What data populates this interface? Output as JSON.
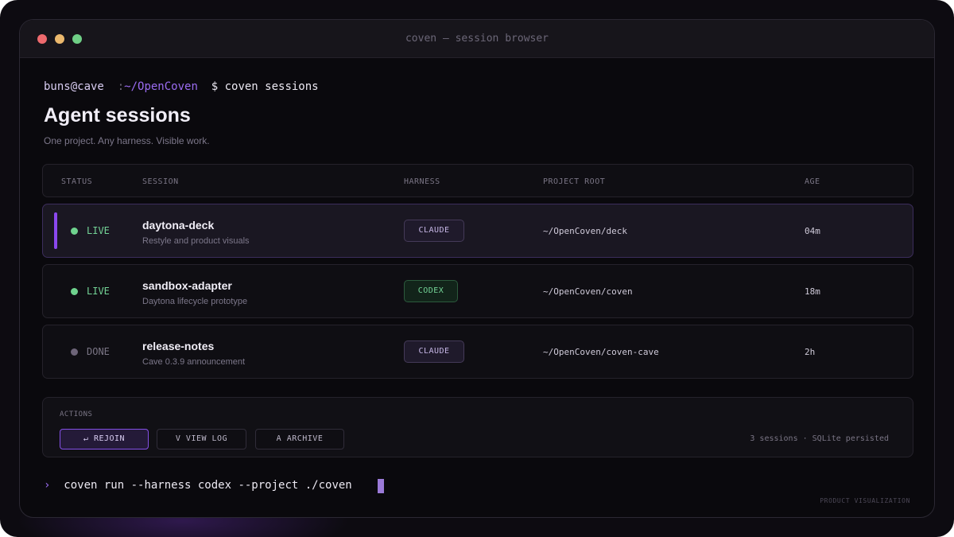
{
  "window": {
    "title": "coven — session browser"
  },
  "prompt": {
    "user": "buns@cave",
    "separator": ":",
    "path": "~/OpenCoven",
    "command": "$ coven sessions"
  },
  "header": {
    "title": "Agent sessions",
    "subtitle": "One project. Any harness. Visible work."
  },
  "table": {
    "columns": [
      "STATUS",
      "SESSION",
      "HARNESS",
      "PROJECT ROOT",
      "AGE"
    ],
    "rows": [
      {
        "status": "LIVE",
        "name": "daytona-deck",
        "description": "Restyle and product visuals",
        "harness": "CLAUDE",
        "root": "~/OpenCoven/deck",
        "age": "04m",
        "selected": true
      },
      {
        "status": "LIVE",
        "name": "sandbox-adapter",
        "description": "Daytona lifecycle prototype",
        "harness": "CODEX",
        "root": "~/OpenCoven/coven",
        "age": "18m",
        "selected": false
      },
      {
        "status": "DONE",
        "name": "release-notes",
        "description": "Cave 0.3.9 announcement",
        "harness": "CLAUDE",
        "root": "~/OpenCoven/coven-cave",
        "age": "2h",
        "selected": false
      }
    ]
  },
  "actions": {
    "label": "ACTIONS",
    "rejoin": "↵ REJOIN",
    "view_log": "V VIEW LOG",
    "archive": "A ARCHIVE",
    "meta": "3 sessions · SQLite persisted"
  },
  "cmdline": {
    "chevron": "›",
    "text": "coven run --harness codex --project ./coven"
  },
  "footer": {
    "note": "PRODUCT VISUALIZATION"
  },
  "colors": {
    "accent": "#8b48ee",
    "live": "#6fd28e",
    "done": "#6d6478",
    "background": "#0a090d"
  },
  "icons": {
    "traffic_lights": [
      "close-dot",
      "minimize-dot",
      "maximize-dot"
    ],
    "status": "status-dot-icon",
    "prompt": "chevron-right-icon"
  }
}
